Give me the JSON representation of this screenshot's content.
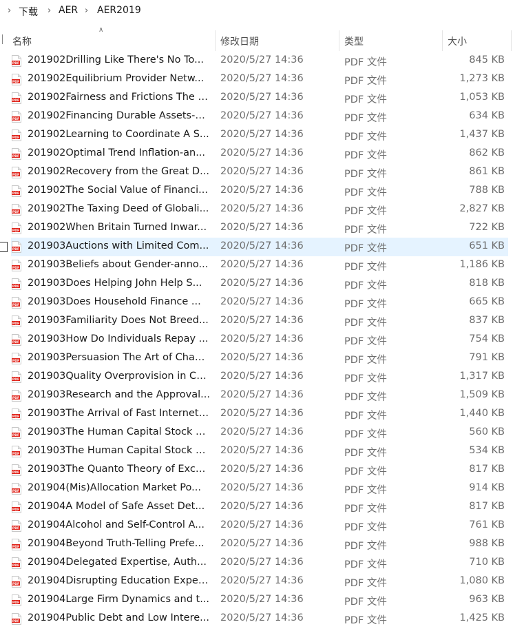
{
  "breadcrumb": [
    "下载",
    "AER",
    "AER2019"
  ],
  "columns": {
    "name": "名称",
    "date": "修改日期",
    "type": "类型",
    "size": "大小"
  },
  "selected_index": 10,
  "files": [
    {
      "name": "201902Drilling Like There's No To...",
      "date": "2020/5/27 14:36",
      "type": "PDF 文件",
      "size": "845 KB"
    },
    {
      "name": "201902Equilibrium Provider Netw...",
      "date": "2020/5/27 14:36",
      "type": "PDF 文件",
      "size": "1,273 KB"
    },
    {
      "name": "201902Fairness and Frictions The I...",
      "date": "2020/5/27 14:36",
      "type": "PDF 文件",
      "size": "1,053 KB"
    },
    {
      "name": "201902Financing Durable Assets-a...",
      "date": "2020/5/27 14:36",
      "type": "PDF 文件",
      "size": "634 KB"
    },
    {
      "name": "201902Learning to Coordinate A S...",
      "date": "2020/5/27 14:36",
      "type": "PDF 文件",
      "size": "1,437 KB"
    },
    {
      "name": "201902Optimal Trend Inflation-an...",
      "date": "2020/5/27 14:36",
      "type": "PDF 文件",
      "size": "862 KB"
    },
    {
      "name": "201902Recovery from the Great D...",
      "date": "2020/5/27 14:36",
      "type": "PDF 文件",
      "size": "861 KB"
    },
    {
      "name": "201902The Social Value of Financi...",
      "date": "2020/5/27 14:36",
      "type": "PDF 文件",
      "size": "788 KB"
    },
    {
      "name": "201902The Taxing Deed of Globali...",
      "date": "2020/5/27 14:36",
      "type": "PDF 文件",
      "size": "2,827 KB"
    },
    {
      "name": "201902When Britain Turned Inwar...",
      "date": "2020/5/27 14:36",
      "type": "PDF 文件",
      "size": "722 KB"
    },
    {
      "name": "201903Auctions with Limited Com...",
      "date": "2020/5/27 14:36",
      "type": "PDF 文件",
      "size": "651 KB"
    },
    {
      "name": "201903Beliefs about Gender-anno...",
      "date": "2020/5/27 14:36",
      "type": "PDF 文件",
      "size": "1,186 KB"
    },
    {
      "name": "201903Does Helping John Help S...",
      "date": "2020/5/27 14:36",
      "type": "PDF 文件",
      "size": "818 KB"
    },
    {
      "name": "201903Does Household Finance ...",
      "date": "2020/5/27 14:36",
      "type": "PDF 文件",
      "size": "665 KB"
    },
    {
      "name": "201903Familiarity Does Not Breed...",
      "date": "2020/5/27 14:36",
      "type": "PDF 文件",
      "size": "837 KB"
    },
    {
      "name": "201903How Do Individuals Repay ...",
      "date": "2020/5/27 14:36",
      "type": "PDF 文件",
      "size": "754 KB"
    },
    {
      "name": "201903Persuasion The Art of Chan...",
      "date": "2020/5/27 14:36",
      "type": "PDF 文件",
      "size": "791 KB"
    },
    {
      "name": "201903Quality Overprovision in Ca...",
      "date": "2020/5/27 14:36",
      "type": "PDF 文件",
      "size": "1,317 KB"
    },
    {
      "name": "201903Research and the Approval...",
      "date": "2020/5/27 14:36",
      "type": "PDF 文件",
      "size": "1,509 KB"
    },
    {
      "name": "201903The Arrival of Fast Internet ...",
      "date": "2020/5/27 14:36",
      "type": "PDF 文件",
      "size": "1,440 KB"
    },
    {
      "name": "201903The Human Capital Stock A...",
      "date": "2020/5/27 14:36",
      "type": "PDF 文件",
      "size": "560 KB"
    },
    {
      "name": "201903The Human Capital Stock A...",
      "date": "2020/5/27 14:36",
      "type": "PDF 文件",
      "size": "534 KB"
    },
    {
      "name": "201903The Quanto Theory of Exch...",
      "date": "2020/5/27 14:36",
      "type": "PDF 文件",
      "size": "817 KB"
    },
    {
      "name": "201904(Mis)Allocation Market Po...",
      "date": "2020/5/27 14:36",
      "type": "PDF 文件",
      "size": "914 KB"
    },
    {
      "name": "201904A Model of Safe Asset Det...",
      "date": "2020/5/27 14:36",
      "type": "PDF 文件",
      "size": "817 KB"
    },
    {
      "name": "201904Alcohol and Self-Control A...",
      "date": "2020/5/27 14:36",
      "type": "PDF 文件",
      "size": "761 KB"
    },
    {
      "name": "201904Beyond Truth-Telling Prefe...",
      "date": "2020/5/27 14:36",
      "type": "PDF 文件",
      "size": "988 KB"
    },
    {
      "name": "201904Delegated Expertise, Auth...",
      "date": "2020/5/27 14:36",
      "type": "PDF 文件",
      "size": "710 KB"
    },
    {
      "name": "201904Disrupting Education Exper...",
      "date": "2020/5/27 14:36",
      "type": "PDF 文件",
      "size": "1,080 KB"
    },
    {
      "name": "201904Large Firm Dynamics and t...",
      "date": "2020/5/27 14:36",
      "type": "PDF 文件",
      "size": "963 KB"
    },
    {
      "name": "201904Public Debt and Low Intere...",
      "date": "2020/5/27 14:36",
      "type": "PDF 文件",
      "size": "1,425 KB"
    }
  ]
}
